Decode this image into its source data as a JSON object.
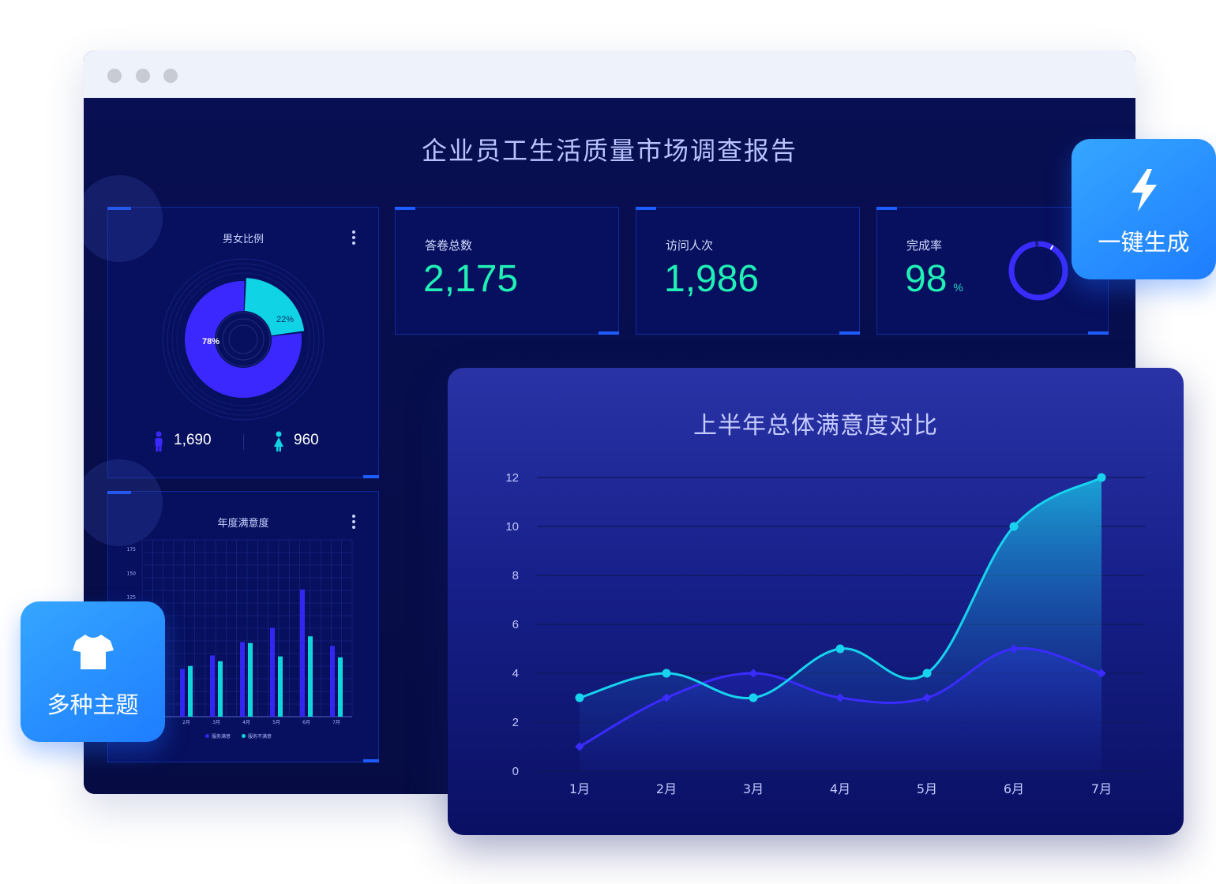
{
  "window": {
    "dots": [
      "close",
      "minimize",
      "maximize"
    ]
  },
  "dashboard": {
    "title": "企业员工生活质量市场调查报告"
  },
  "gender_panel": {
    "title": "男女比例",
    "male_percent_label": "78%",
    "female_percent_label": "22%",
    "male_count": "1,690",
    "female_count": "960",
    "male_fraction": 0.78,
    "female_fraction": 0.22,
    "colors": {
      "male": "#3b28ff",
      "female": "#10d4e6"
    }
  },
  "stats": {
    "surveys": {
      "label": "答卷总数",
      "value": "2,175"
    },
    "visits": {
      "label": "访问人次",
      "value": "1,986"
    },
    "completion": {
      "label": "完成率",
      "value": "98",
      "unit": "%",
      "fraction": 0.98
    }
  },
  "annual_panel": {
    "title": "年度满意度",
    "y_ticks": [
      "175",
      "150",
      "125"
    ],
    "months": [
      "2月",
      "3月",
      "4月",
      "5月",
      "6月",
      "7月"
    ],
    "satisfied": [
      50,
      64,
      78,
      93,
      133,
      74
    ],
    "unsatisfied": [
      53,
      58,
      77,
      63,
      84,
      62
    ],
    "legend": [
      "服务满意",
      "服务不满意"
    ],
    "colors": {
      "satisfied": "#3326f0",
      "unsatisfied": "#11d5da"
    }
  },
  "badges": {
    "generate": {
      "label": "一键生成",
      "icon": "lightning-icon"
    },
    "themes": {
      "label": "多种主题",
      "icon": "tshirt-icon"
    }
  },
  "chart_data": {
    "type": "line",
    "title": "上半年总体满意度对比",
    "categories": [
      "1月",
      "2月",
      "3月",
      "4月",
      "5月",
      "6月",
      "7月"
    ],
    "series": [
      {
        "values": [
          3,
          4,
          3,
          5,
          4,
          10,
          12
        ],
        "color": "#17d3ee"
      },
      {
        "values": [
          1,
          3,
          4,
          3,
          3,
          5,
          4
        ],
        "color": "#3a2bff"
      }
    ],
    "ylim": [
      0,
      12
    ],
    "y_ticks": [
      "0",
      "2",
      "4",
      "6",
      "8",
      "10",
      "12"
    ],
    "grid": true,
    "xlabel": "",
    "ylabel": ""
  }
}
